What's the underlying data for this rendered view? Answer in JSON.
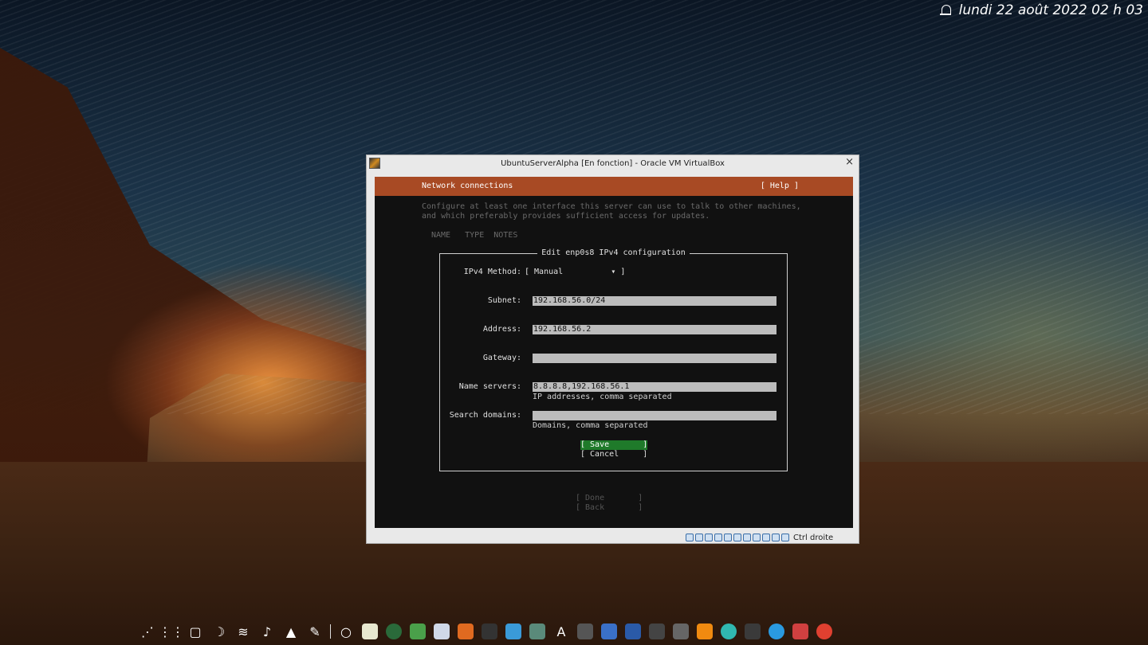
{
  "clock": {
    "text": "lundi 22 août 2022   02 h 03"
  },
  "window": {
    "title": "UbuntuServerAlpha [En fonction] - Oracle VM VirtualBox",
    "close": "×",
    "status_host_key": "Ctrl droite"
  },
  "installer": {
    "header_title": "Network connections",
    "help": "[ Help ]",
    "description_line1": "Configure at least one interface this server can use to talk to other machines,",
    "description_line2": "and which preferably provides sufficient access for updates.",
    "columns": "NAME   TYPE  NOTES",
    "dialog": {
      "title": "Edit enp0s8 IPv4 configuration",
      "method_label": "IPv4 Method:",
      "method_value": "[ Manual          ▾ ]",
      "subnet_label": "Subnet:",
      "subnet_value": "192.168.56.0/24",
      "address_label": "Address:",
      "address_value": "192.168.56.2",
      "gateway_label": "Gateway:",
      "gateway_value": "",
      "nameservers_label": "Name servers:",
      "nameservers_value": "8.8.8.8,192.168.56.1",
      "nameservers_hint": "IP addresses, comma separated",
      "search_label": "Search domains:",
      "search_value": "",
      "search_hint": "Domains, comma separated",
      "save": "[ Save       ]",
      "cancel": "[ Cancel     ]"
    },
    "done": "[ Done       ]",
    "back": "[ Back       ]"
  },
  "colors": {
    "header": "#a84a24",
    "save_button": "#1f7a2a",
    "terminal_bg": "#111111"
  },
  "taskbar_icons": [
    "launcher-icon",
    "apps-grid-icon",
    "desktop-icon",
    "night-light-icon",
    "wifi-icon",
    "volume-icon",
    "tray-arrow-icon",
    "color-picker-icon",
    "circle-icon",
    "text-editor-icon",
    "browser-icon",
    "notes-icon",
    "virtualbox-icon",
    "app-icon",
    "terminal-icon",
    "files-icon",
    "image-viewer-icon",
    "font-icon",
    "calculator-icon",
    "store-icon",
    "word-icon",
    "game-icon",
    "inkscape-icon",
    "vlc-icon",
    "mail-icon",
    "console-icon",
    "telegram-icon",
    "archive-icon",
    "chrome-icon"
  ]
}
